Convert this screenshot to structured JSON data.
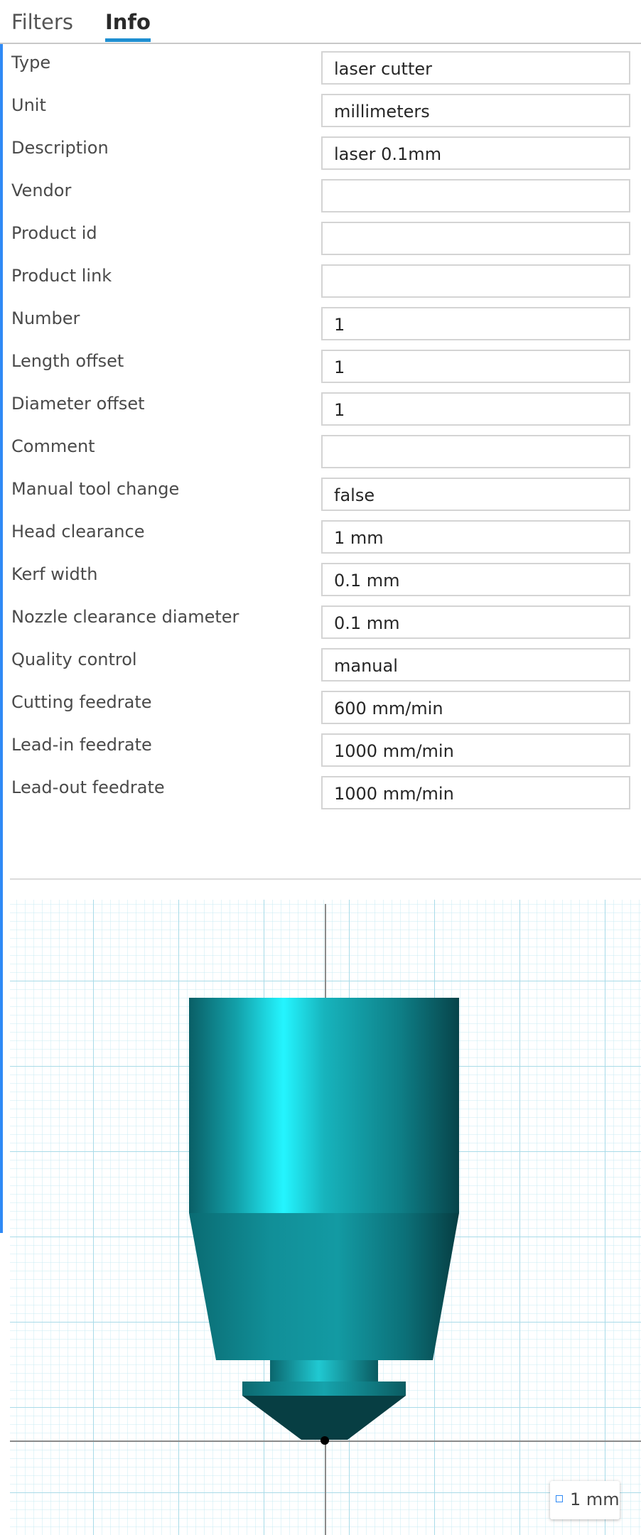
{
  "tabs": {
    "filters": "Filters",
    "info": "Info"
  },
  "properties": [
    {
      "label": "Type",
      "value": "laser cutter"
    },
    {
      "label": "Unit",
      "value": "millimeters"
    },
    {
      "label": "Description",
      "value": "laser 0.1mm"
    },
    {
      "label": "Vendor",
      "value": ""
    },
    {
      "label": "Product id",
      "value": ""
    },
    {
      "label": "Product link",
      "value": ""
    },
    {
      "label": "Number",
      "value": "1"
    },
    {
      "label": "Length offset",
      "value": "1"
    },
    {
      "label": "Diameter offset",
      "value": "1"
    },
    {
      "label": "Comment",
      "value": ""
    },
    {
      "label": "Manual tool change",
      "value": "false"
    },
    {
      "label": "Head clearance",
      "value": "1 mm"
    },
    {
      "label": "Kerf width",
      "value": "0.1 mm"
    },
    {
      "label": "Nozzle clearance diameter",
      "value": "0.1 mm"
    },
    {
      "label": "Quality control",
      "value": "manual"
    },
    {
      "label": "Cutting feedrate",
      "value": "600 mm/min"
    },
    {
      "label": "Lead-in feedrate",
      "value": "1000 mm/min"
    },
    {
      "label": "Lead-out feedrate",
      "value": "1000 mm/min"
    }
  ],
  "preview": {
    "scale_label": "1 mm",
    "tool_color": "#13a3ad",
    "grid_color": "#b5e3ee"
  }
}
